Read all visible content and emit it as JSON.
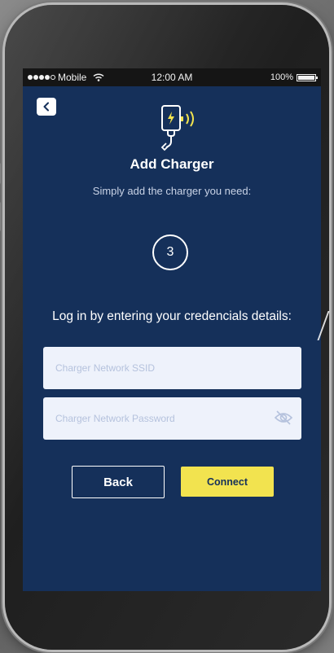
{
  "status_bar": {
    "carrier": "Mobile",
    "time": "12:00 AM",
    "battery": "100%"
  },
  "header": {
    "title": "Add Charger",
    "subtitle": "Simply add the charger you need:"
  },
  "step": {
    "number": "3"
  },
  "form": {
    "instruction": "Log in by entering your credencials details:",
    "ssid_placeholder": "Charger Network SSID",
    "password_placeholder": "Charger Network Password"
  },
  "buttons": {
    "back_label": "Back",
    "connect_label": "Connect"
  },
  "colors": {
    "screen_bg": "#15305a",
    "accent_yellow": "#f2e34f",
    "input_bg": "#eef2fb"
  },
  "icons": {
    "back": "chevron-left-icon",
    "charger": "charger-icon",
    "eye": "eye-off-icon",
    "wifi": "wifi-icon"
  }
}
